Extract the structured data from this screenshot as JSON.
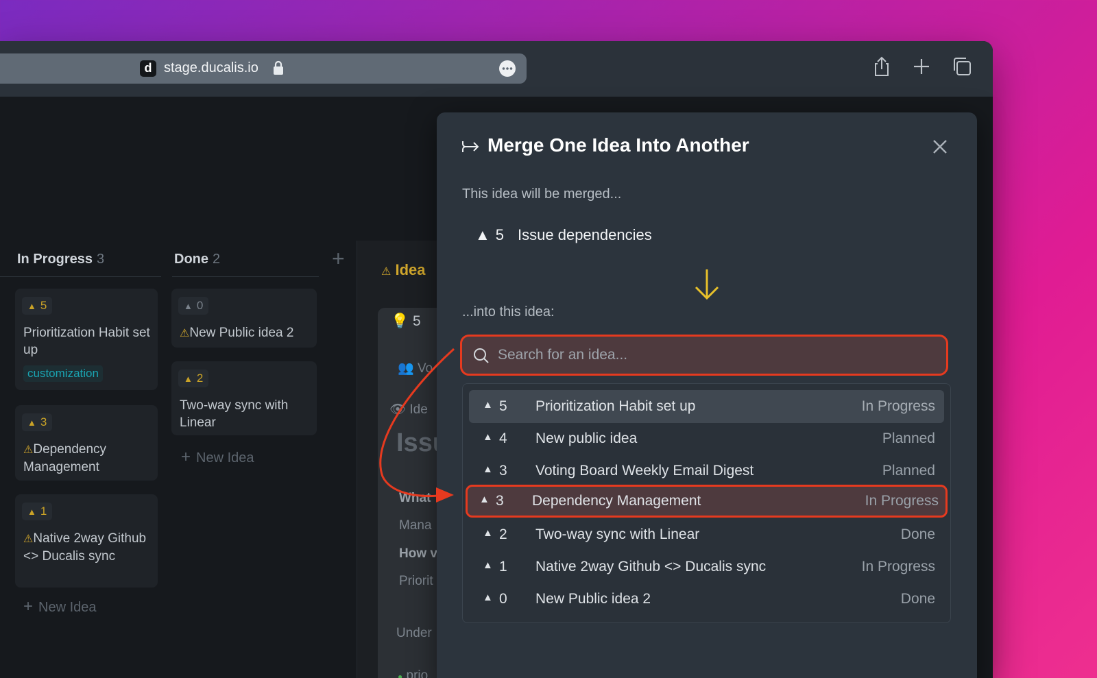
{
  "browser": {
    "favicon_letter": "d",
    "url": "stage.ducalis.io"
  },
  "board": {
    "columns": [
      {
        "title": "In Progress",
        "count": "3"
      },
      {
        "title": "Done",
        "count": "2"
      }
    ],
    "in_progress_cards": [
      {
        "votes": "5",
        "title": "Prioritization Habit set up",
        "tag": "customization"
      },
      {
        "votes": "3",
        "title": "Dependency Management"
      },
      {
        "votes": "1",
        "title": "Native 2way Github <> Ducalis sync"
      }
    ],
    "done_cards": [
      {
        "votes": "0",
        "title": "New Public idea 2"
      },
      {
        "votes": "2",
        "title": "Two-way sync with Linear"
      }
    ],
    "new_idea_label": "New Idea",
    "detail": {
      "header": "Idea",
      "votes": "5",
      "votes_label": "Vo",
      "visibility_label": "Ide",
      "title_fragment": "Issu",
      "what_fragment": "What",
      "mana_fragment": "Mana",
      "how_fragment": "How v",
      "priorit_fragment": "Priorit",
      "under_fragment": "Under",
      "prio_fragment": "prio"
    }
  },
  "modal": {
    "title": "Merge One Idea Into Another",
    "merged_label": "This idea will be merged...",
    "source": {
      "votes": "5",
      "title": "Issue dependencies"
    },
    "into_label": "...into this idea:",
    "search_placeholder": "Search for an idea...",
    "results": [
      {
        "votes": "5",
        "title": "Prioritization Habit set up",
        "status": "In Progress"
      },
      {
        "votes": "4",
        "title": "New public idea",
        "status": "Planned"
      },
      {
        "votes": "3",
        "title": "Voting Board Weekly Email Digest",
        "status": "Planned"
      },
      {
        "votes": "3",
        "title": "Dependency Management",
        "status": "In Progress"
      },
      {
        "votes": "2",
        "title": "Two-way sync with Linear",
        "status": "Done"
      },
      {
        "votes": "1",
        "title": "Native 2way Github <> Ducalis sync",
        "status": "In Progress"
      },
      {
        "votes": "0",
        "title": "New Public idea 2",
        "status": "Done"
      }
    ]
  },
  "colors": {
    "accent_highlight": "#e63a1f",
    "arrow_yellow": "#e8c12b",
    "warning": "#d0a62c"
  }
}
